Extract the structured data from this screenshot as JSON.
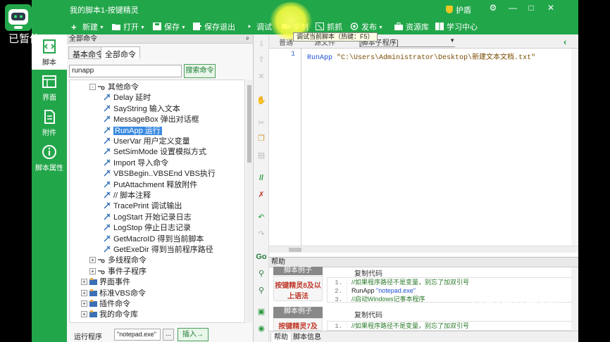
{
  "overlay": {
    "paused_text": "已暂停"
  },
  "window": {
    "title": "我的脚本1-按键精灵",
    "shield_label": "护盾",
    "controls": {
      "settings": "⚙",
      "minimize": "—",
      "maximize": "□",
      "close": "✕"
    }
  },
  "toolbar": {
    "new": "新建",
    "open": "打开",
    "save": "保存",
    "save_exit": "保存退出",
    "debug": "调试",
    "record": "录制",
    "capture": "抓抓",
    "publish": "发布",
    "resources": "资源库",
    "learning": "学习中心"
  },
  "nav": [
    {
      "label": "脚本",
      "icon": "script-icon"
    },
    {
      "label": "界面",
      "icon": "interface-icon"
    },
    {
      "label": "附件",
      "icon": "attachment-icon"
    },
    {
      "label": "脚本属性",
      "icon": "info-icon"
    }
  ],
  "command_panel": {
    "header": "全部命令",
    "tabs": [
      "基本命令",
      "全部命令"
    ],
    "search_value": "runapp",
    "search_button": "搜索命令",
    "tree": [
      {
        "label": "其他命令",
        "level": 1,
        "expander": "-"
      },
      {
        "label": "Delay 延时",
        "level": 2
      },
      {
        "label": "SayString 输入文本",
        "level": 2
      },
      {
        "label": "MessageBox 弹出对话框",
        "level": 2
      },
      {
        "label": "RunApp 运行",
        "level": 2,
        "selected": true
      },
      {
        "label": "UserVar 用户定义变量",
        "level": 2
      },
      {
        "label": "SetSimMode 设置模拟方式",
        "level": 2
      },
      {
        "label": "Import 导入命令",
        "level": 2
      },
      {
        "label": "VBSBegin..VBSEnd VBS执行",
        "level": 2
      },
      {
        "label": "PutAttachment 释放附件",
        "level": 2
      },
      {
        "label": "// 脚本注释",
        "level": 2
      },
      {
        "label": "TracePrint 调试输出",
        "level": 2
      },
      {
        "label": "LogStart 开始记录日志",
        "level": 2
      },
      {
        "label": "LogStop 停止日志记录",
        "level": 2
      },
      {
        "label": "GetMacroID 得到当前脚本",
        "level": 2
      },
      {
        "label": "GetExeDir 得到当前程序路径",
        "level": 2
      },
      {
        "label": "多线程命令",
        "level": 1,
        "expander": "+"
      },
      {
        "label": "事件子程序",
        "level": 1,
        "expander": "+"
      },
      {
        "label": "界面事件",
        "level": 0,
        "expander": "+"
      },
      {
        "label": "标准VBS命令",
        "level": 0,
        "expander": "+"
      },
      {
        "label": "插件命令",
        "level": 0,
        "expander": "+"
      },
      {
        "label": "我的命令库",
        "level": 0,
        "expander": "+"
      }
    ],
    "run_label": "运行程序",
    "run_value": "\"notepad.exe\"",
    "browse": "...",
    "insert": "插入→"
  },
  "editor": {
    "tabs": {
      "normal": "普通",
      "source": "源文件"
    },
    "tooltip": "调试当前脚本（热键：F5）",
    "sub_combo": "[脚本子程序]",
    "line_number": "1",
    "code_keyword": "RunApp",
    "code_string": "\"C:\\Users\\Administrator\\Desktop\\新建文本文档.txt\""
  },
  "help": {
    "title": "帮助",
    "example_label": "脚本例子",
    "block1_title": "按键精灵8及以上语法",
    "block1_copy": "复制代码",
    "block1_lines": [
      {
        "num": "1.",
        "text": "//如果程序路径不是变量，别忘了加双引号",
        "kind": "comment"
      },
      {
        "num": "2.",
        "cmd": "RunApp ",
        "str": "\"notepad.exe\"",
        "kind": "code"
      },
      {
        "num": "3.",
        "text": "//启动Windows记事本程序",
        "kind": "comment"
      }
    ],
    "block2_title": "按键精灵7及",
    "block2_copy": "复制代码",
    "block2_lines": [
      {
        "num": "1.",
        "text": "//如果程序路径不是变量，别忘了加双引号",
        "kind": "comment"
      }
    ],
    "tabs": [
      "帮助",
      "脚本信息"
    ]
  },
  "watermark": {
    "brand": "Baidu经验",
    "sub": "jingyan.baidu.com"
  },
  "colors": {
    "brand_green": "#22a64a",
    "selection_blue": "#3b8be0",
    "example_red": "#c0392b"
  }
}
